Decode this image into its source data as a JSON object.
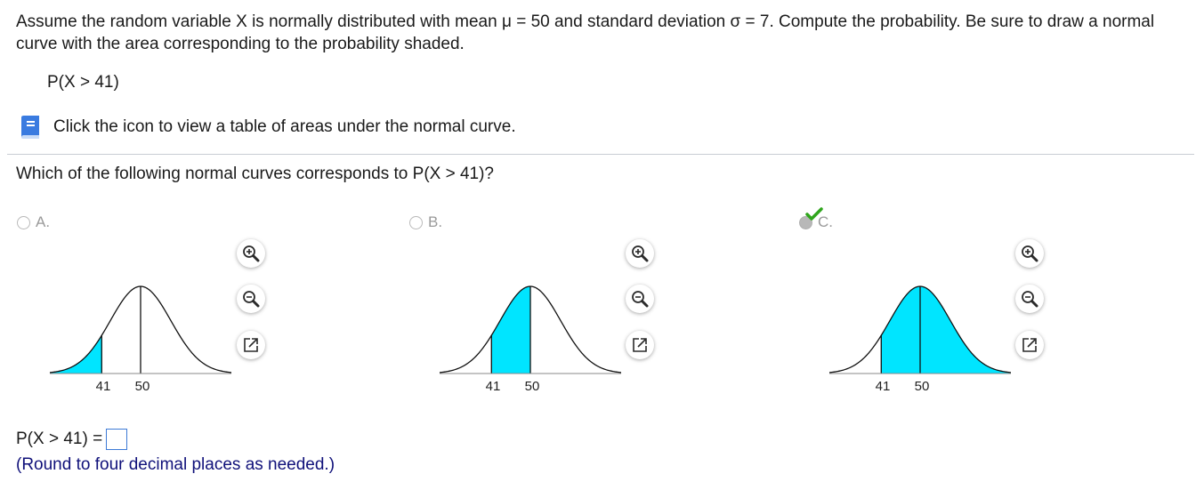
{
  "problem": {
    "text": "Assume the random variable X is normally distributed with mean μ = 50 and standard deviation σ = 7. Compute the probability. Be sure to draw a normal curve with the area corresponding to the probability shaded.",
    "probability_expr": "P(X > 41)"
  },
  "table_link": {
    "icon": "book-icon",
    "text": "Click the icon to view a table of areas under the normal curve."
  },
  "question": "Which of the following normal curves corresponds to P(X > 41)?",
  "options": [
    {
      "letter": "A.",
      "selected": false,
      "shaded_region": "left of 41",
      "ticks": [
        "41",
        "50"
      ]
    },
    {
      "letter": "B.",
      "selected": false,
      "shaded_region": "between 41 and 50",
      "ticks": [
        "41",
        "50"
      ]
    },
    {
      "letter": "C.",
      "selected": true,
      "correct_mark": "checkmark-icon",
      "shaded_region": "right of 41",
      "ticks": [
        "41",
        "50"
      ]
    }
  ],
  "graph_buttons": [
    "zoom-in-icon",
    "zoom-out-icon",
    "pop-out-icon"
  ],
  "answer": {
    "label": "P(X > 41) =",
    "value": "",
    "hint": "(Round to four decimal places as needed.)"
  },
  "colors": {
    "shade": "#00e5ff",
    "hint_text": "#10117a",
    "check": "#2fa51c",
    "answer_box_border": "#3d7ad6"
  }
}
